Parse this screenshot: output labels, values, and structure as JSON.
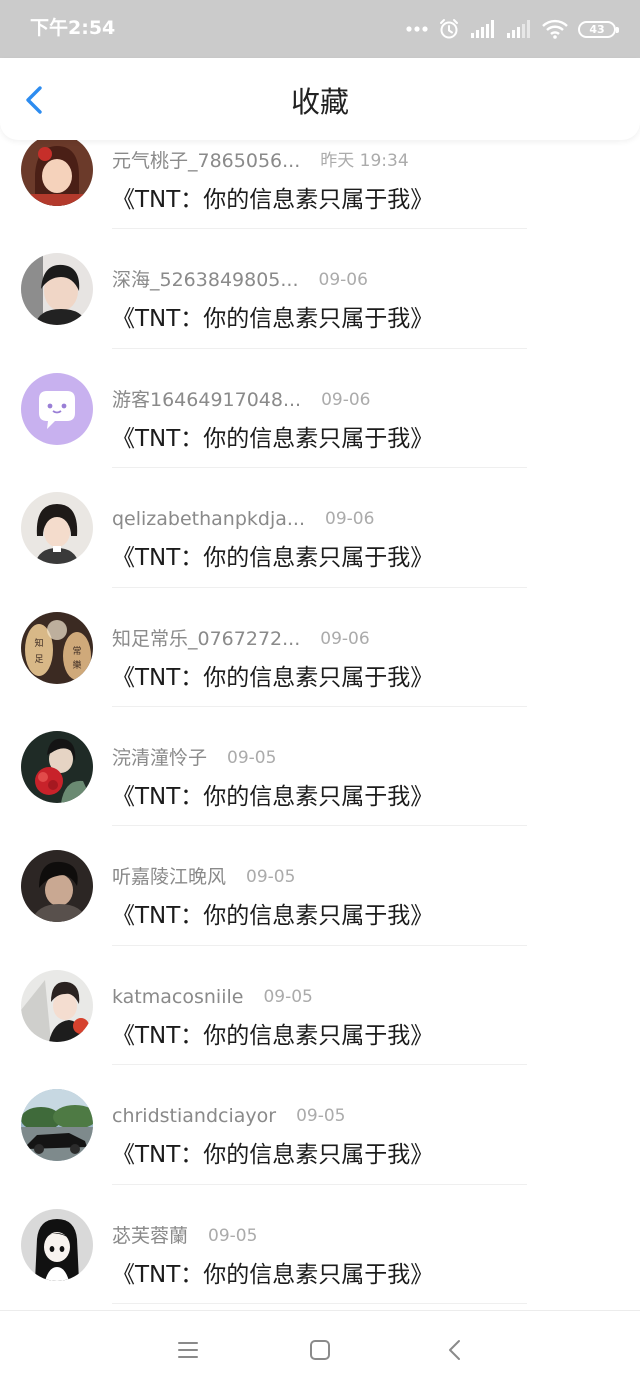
{
  "status_bar": {
    "time": "下午2:54",
    "battery": "43",
    "icons": [
      "more-dots-icon",
      "alarm-icon",
      "signal-icon",
      "signal-icon",
      "wifi-icon",
      "battery-icon"
    ]
  },
  "nav": {
    "title": "收藏",
    "back_icon": "back-chevron-icon"
  },
  "items": [
    {
      "user": "元气桃子_7865056...",
      "time": "昨天 19:34",
      "content": "《TNT：你的信息素只属于我》",
      "avatar": "girl-avatar"
    },
    {
      "user": "深海_5263849805...",
      "time": "09-06",
      "content": "《TNT：你的信息素只属于我》",
      "avatar": "boy-avatar"
    },
    {
      "user": "游客16464917048...",
      "time": "09-06",
      "content": "《TNT：你的信息素只属于我》",
      "avatar": "chat-bubble-avatar"
    },
    {
      "user": "qelizabethanpkdja...",
      "time": "09-06",
      "content": "《TNT：你的信息素只属于我》",
      "avatar": "girl-avatar"
    },
    {
      "user": "知足常乐_0767272...",
      "time": "09-06",
      "content": "《TNT：你的信息素只属于我》",
      "avatar": "text-avatar"
    },
    {
      "user": "浣清潼怜子",
      "time": "09-05",
      "content": "《TNT：你的信息素只属于我》",
      "avatar": "flower-avatar"
    },
    {
      "user": "听嘉陵江晚风",
      "time": "09-05",
      "content": "《TNT：你的信息素只属于我》",
      "avatar": "boy-avatar"
    },
    {
      "user": "katmacosniile",
      "time": "09-05",
      "content": "《TNT：你的信息素只属于我》",
      "avatar": "boy-avatar"
    },
    {
      "user": "chridstiandciayor",
      "time": "09-05",
      "content": "《TNT：你的信息素只属于我》",
      "avatar": "car-avatar"
    },
    {
      "user": "苾芙蓉蘭",
      "time": "09-05",
      "content": "《TNT：你的信息素只属于我》",
      "avatar": "anime-girl-avatar"
    }
  ],
  "bottom_nav": {
    "icons": [
      "menu-icon",
      "home-square-icon",
      "back-triangle-icon"
    ]
  },
  "colors": {
    "status_bar_bg": "#cbcbcb",
    "accent_blue": "#2d8cf0",
    "username_gray": "#8a8a8a",
    "time_gray": "#ababab",
    "content_text": "#1c1c1c"
  }
}
